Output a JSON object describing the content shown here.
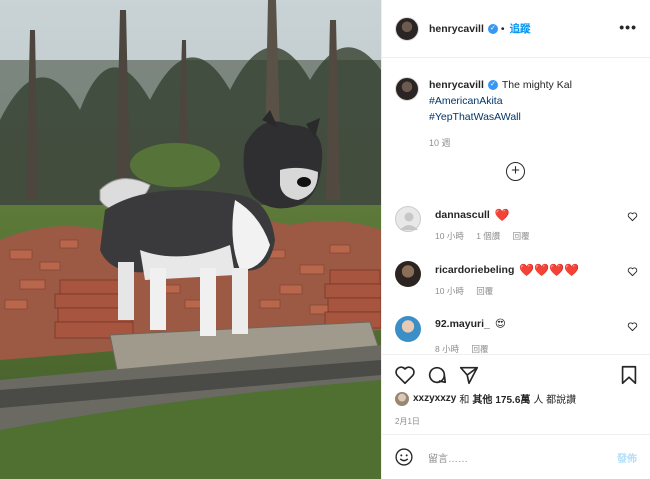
{
  "post": {
    "username": "henrycavill",
    "follow_label": "追蹤",
    "more_label": "•••",
    "caption": {
      "username": "henrycavill",
      "text": "The mighty Kal",
      "hashtags": [
        "#AmericanAkita",
        "#YepThatWasAWall"
      ],
      "time_ago": "10 週"
    },
    "load_more_label": "+",
    "comments": [
      {
        "username": "dannascull",
        "text": "❤️",
        "time": "10 小時",
        "likes": "1 個讚",
        "reply": "回覆"
      },
      {
        "username": "ricardoriebeling",
        "text": "❤️❤️❤️❤️",
        "time": "10 小時",
        "likes": "",
        "reply": "回覆"
      },
      {
        "username": "92.mayuri_",
        "text": "😍",
        "time": "8 小時",
        "likes": "",
        "reply": "回覆"
      }
    ],
    "likes": {
      "liker": "xxzyxxzy",
      "and_label": "和",
      "others_label": "其他",
      "count": "175.6萬",
      "suffix": "人 都說讚"
    },
    "date": "2月1日",
    "add_comment_placeholder": "留言……",
    "post_button": "發佈"
  },
  "colors": {
    "accent": "#0095f6",
    "verified": "#3897f0",
    "heart": "#e0245e",
    "muted": "#8e8e8e"
  },
  "icons": [
    "verified-badge-icon",
    "more-options-icon",
    "plus-circle-icon",
    "heart-icon",
    "comment-icon",
    "share-icon",
    "bookmark-icon",
    "emoji-icon"
  ]
}
